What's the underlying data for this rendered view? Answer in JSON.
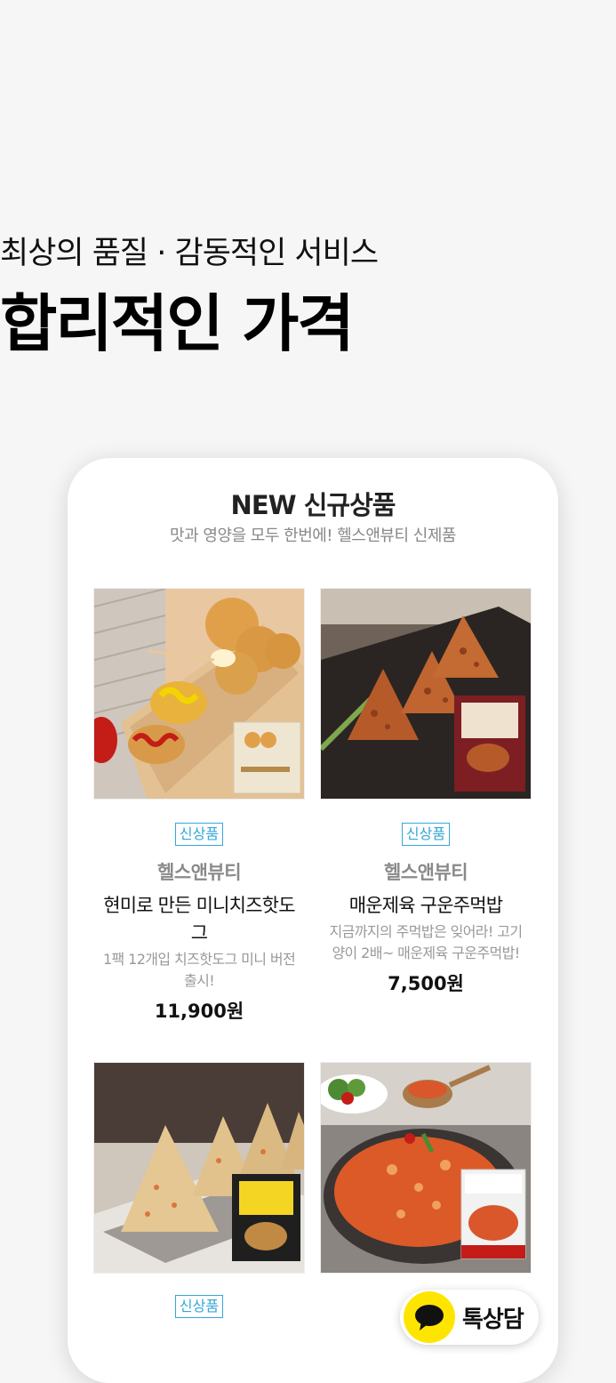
{
  "hero": {
    "subtitle": "최상의 품질 · 감동적인 서비스",
    "title": "합리적인 가격"
  },
  "section": {
    "title": "NEW 신규상품",
    "subtitle": "맛과 영양을 모두 한번에! 헬스앤뷰티 신제품"
  },
  "products": [
    {
      "badge": "신상품",
      "brand": "헬스앤뷰티",
      "name": "현미로 만든 미니치즈핫도그",
      "desc": "1팩 12개입 치즈핫도그 미니 버전 출시!",
      "price": "11,900원",
      "image": "mini-cheese-hotdog-photo"
    },
    {
      "badge": "신상품",
      "brand": "헬스앤뷰티",
      "name": "매운제육 구운주먹밥",
      "desc": "지금까지의 주먹밥은 잊어라! 고기양이 2배~ 매운제육 구운주먹밥!",
      "price": "7,500원",
      "image": "spicy-pork-rice-ball-photo"
    },
    {
      "badge": "신상품",
      "image": "grilled-rice-ball-photo"
    },
    {
      "image": "spicy-fried-rice-photo"
    }
  ],
  "chat_button": {
    "label": "톡상담",
    "icon": "chat-bubble-icon"
  },
  "colors": {
    "badge": "#33a7d8",
    "chat_yellow": "#fee500"
  }
}
